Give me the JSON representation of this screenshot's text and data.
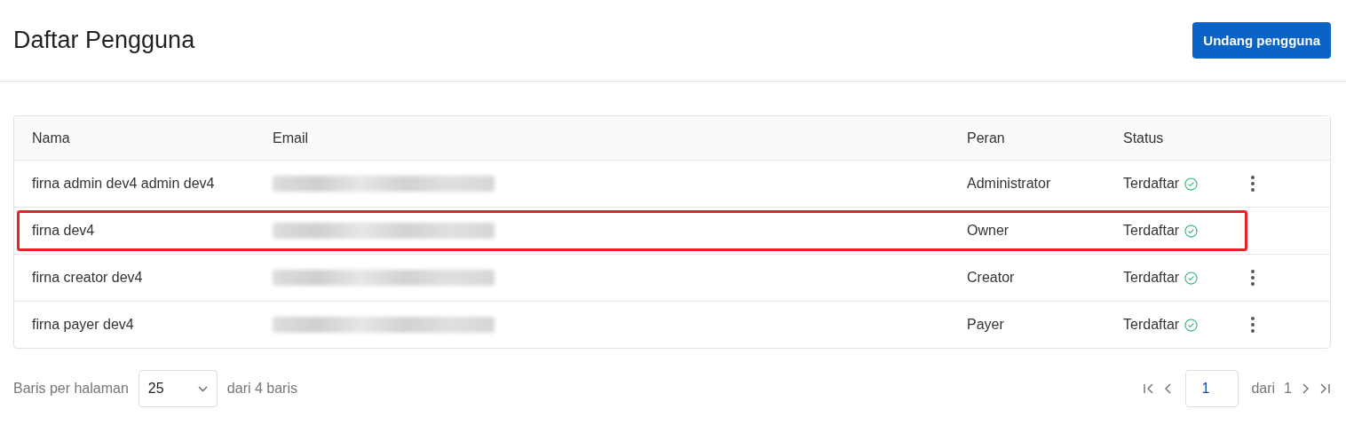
{
  "page": {
    "title": "Daftar Pengguna",
    "invite_button": "Undang pengguna"
  },
  "table": {
    "columns": [
      "Nama",
      "Email",
      "Peran",
      "Status"
    ],
    "rows": [
      {
        "name": "firna admin dev4 admin dev4",
        "role": "Administrator",
        "status": "Terdaftar",
        "has_menu": true,
        "highlighted": false
      },
      {
        "name": "firna dev4",
        "role": "Owner",
        "status": "Terdaftar",
        "has_menu": false,
        "highlighted": true
      },
      {
        "name": "firna creator dev4",
        "role": "Creator",
        "status": "Terdaftar",
        "has_menu": true,
        "highlighted": false
      },
      {
        "name": "firna payer dev4",
        "role": "Payer",
        "status": "Terdaftar",
        "has_menu": true,
        "highlighted": false
      }
    ]
  },
  "pagination": {
    "rows_per_page_label": "Baris per halaman",
    "rows_per_page": "25",
    "total": "dari 4 baris",
    "page": "1",
    "of_label": "dari",
    "page_count": "1"
  }
}
